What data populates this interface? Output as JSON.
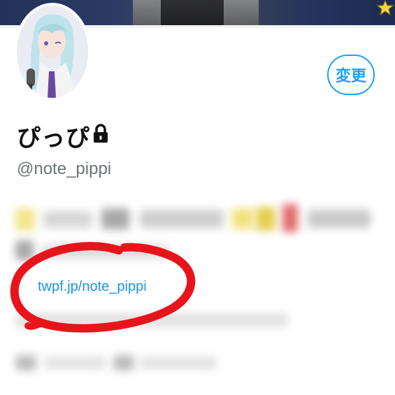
{
  "profile": {
    "display_name": "ぴっぴ",
    "handle": "@note_pippi",
    "link": "twpf.jp/note_pippi"
  },
  "actions": {
    "change_label": "変更"
  },
  "icons": {
    "lock": "lock-icon",
    "star": "star-icon"
  },
  "colors": {
    "accent": "#1da1f2",
    "link": "#1b95e0",
    "annotation": "#e8141c",
    "banner": "#22325a"
  }
}
